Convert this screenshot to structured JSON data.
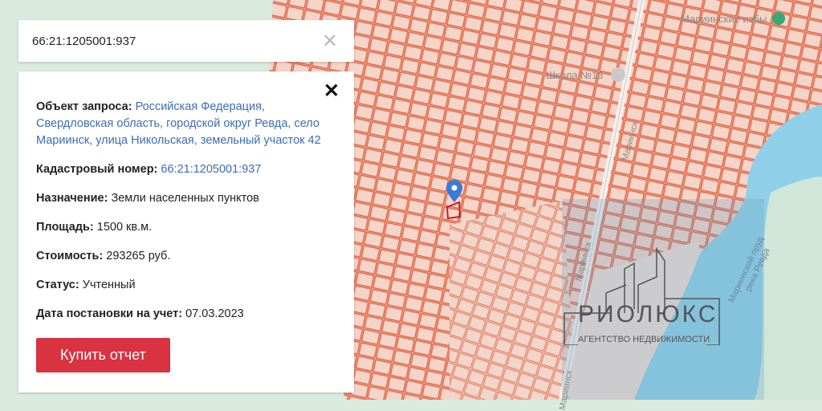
{
  "search": {
    "value": "66:21:1205001:937"
  },
  "card": {
    "rows": [
      {
        "label": "Объект запроса:",
        "value": "Российская Федерация, Свердловская область, городской округ Ревда, село Мариинск, улица Никольская, земельный участок 42",
        "link": true
      },
      {
        "label": "Кадастровый номер:",
        "value": "66:21:1205001:937",
        "link": true
      },
      {
        "label": "Назначение:",
        "value": "Земли населенных пунктов"
      },
      {
        "label": "Площадь:",
        "value": "1500 кв.м."
      },
      {
        "label": "Стоимость:",
        "value": "293265 руб."
      },
      {
        "label": "Статус:",
        "value": "Учтенный"
      },
      {
        "label": "Дата постановки на учет:",
        "value": "07.03.2023"
      }
    ],
    "buy_label": "Купить отчет"
  },
  "map": {
    "labels": {
      "izby": "Мариинские избы",
      "school": "Школа №13",
      "street1": "Мариинск",
      "street2": "Мариинск",
      "street3": "Мариинск",
      "pond": "Мариинский пруд",
      "river": "река Ревда"
    }
  },
  "watermark": {
    "brand": "РИОЛЮКС",
    "subtitle": "АГЕНТСТВО НЕДВИЖИМОСТИ"
  },
  "colors": {
    "parcel_line": "#e0603f",
    "parcel_fill": "#f5d5c9",
    "water": "#8fd0e8",
    "button": "#d93240",
    "link": "#3b6db3"
  }
}
